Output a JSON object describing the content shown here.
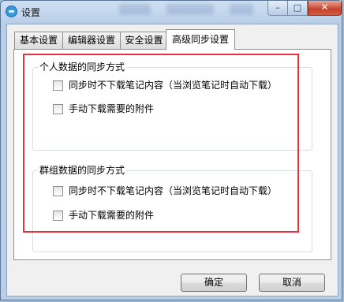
{
  "window": {
    "title": "设置"
  },
  "tabs": [
    {
      "label": "基本设置",
      "active": false
    },
    {
      "label": "编辑器设置",
      "active": false
    },
    {
      "label": "安全设置",
      "active": false
    },
    {
      "label": "高级同步设置",
      "active": true
    }
  ],
  "groups": {
    "personal": {
      "title": "个人数据的同步方式",
      "options": [
        {
          "label": "同步时不下载笔记内容（当浏览笔记时自动下载）",
          "checked": false
        },
        {
          "label": "手动下载需要的附件",
          "checked": false
        }
      ]
    },
    "group": {
      "title": "群组数据的同步方式",
      "options": [
        {
          "label": "同步时不下载笔记内容（当浏览笔记时自动下载）",
          "checked": false
        },
        {
          "label": "手动下载需要的附件",
          "checked": false
        }
      ]
    }
  },
  "buttons": {
    "ok": "确定",
    "cancel": "取消"
  },
  "titlebar_buttons": {
    "minimize": "–",
    "maximize": "□",
    "close": "✕"
  },
  "colors": {
    "highlight": "#e5333f",
    "titlebar": "#b9cfe8",
    "close_button": "#c6422c"
  }
}
